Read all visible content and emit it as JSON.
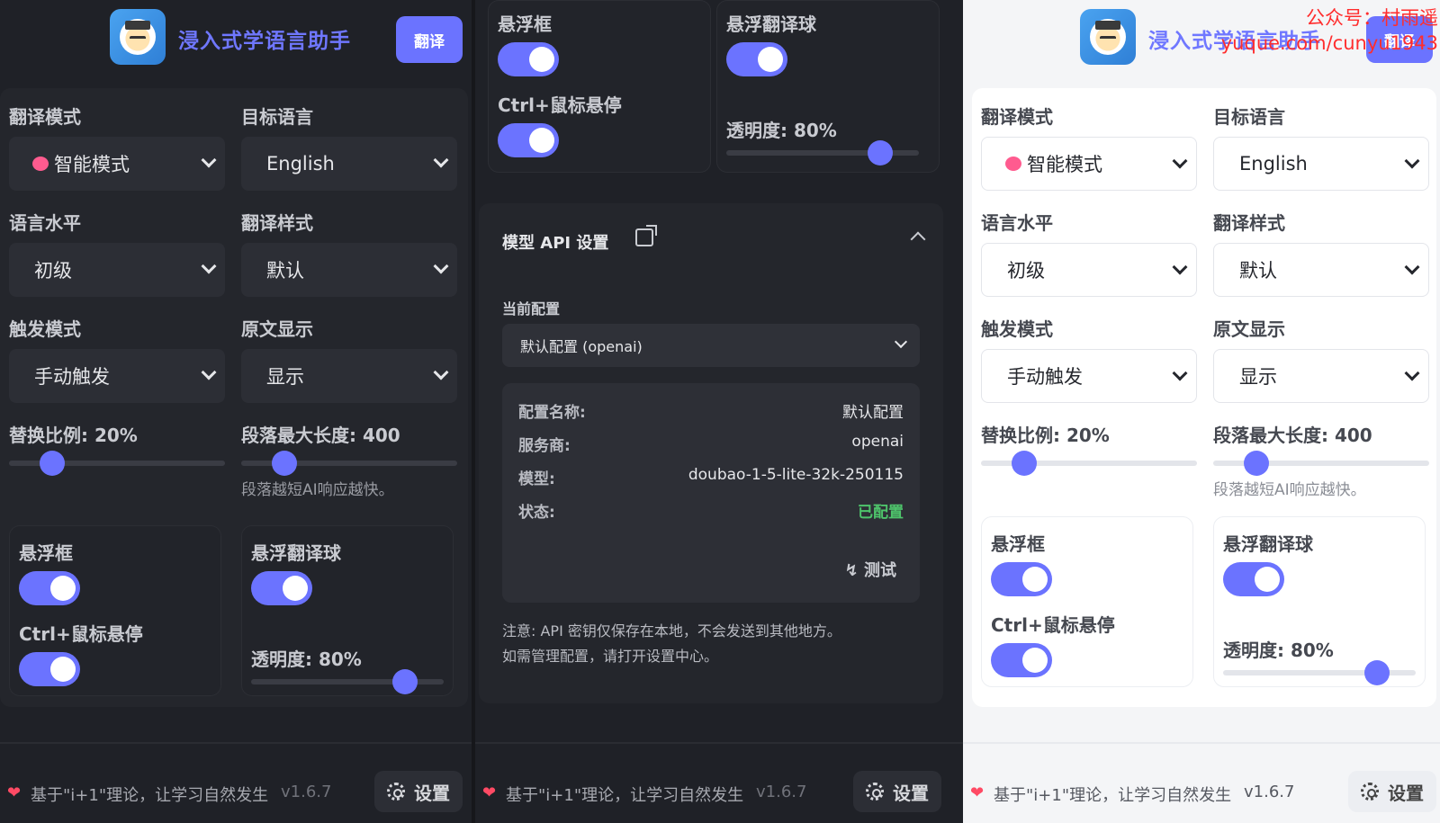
{
  "app": {
    "title": "浸入式学语言助手",
    "translate_button": "翻译"
  },
  "settings": {
    "translate_mode_label": "翻译模式",
    "translate_mode_value": "智能模式",
    "target_lang_label": "目标语言",
    "target_lang_value": "English",
    "level_label": "语言水平",
    "level_value": "初级",
    "style_label": "翻译样式",
    "style_value": "默认",
    "trigger_label": "触发模式",
    "trigger_value": "手动触发",
    "original_label": "原文显示",
    "original_value": "显示",
    "ratio_label": "替换比例: 20%",
    "ratio_value": 0.2,
    "maxlen_label": "段落最大长度: 400",
    "maxlen_value": 0.2,
    "maxlen_hint": "段落越短AI响应越快。",
    "float_box_label": "悬浮框",
    "ctrl_hover_label": "Ctrl+鼠标悬停",
    "float_ball_label": "悬浮翻译球",
    "opacity_label": "透明度: 80%",
    "opacity_value": 0.8
  },
  "api": {
    "title": "模型 API 设置",
    "current_label": "当前配置",
    "current_value": "默认配置 (openai)",
    "rows": [
      {
        "k": "配置名称:",
        "v": "默认配置"
      },
      {
        "k": "服务商:",
        "v": "openai"
      },
      {
        "k": "模型:",
        "v": "doubao-1-5-lite-32k-250115"
      },
      {
        "k": "状态:",
        "v": "已配置"
      }
    ],
    "test_button": "测试",
    "note_line1": "注意: API 密钥仅保存在本地，不会发送到其他地方。",
    "note_line2": "如需管理配置，请打开设置中心。"
  },
  "footer": {
    "slogan": "基于\"i+1\"理论，让学习自然发生",
    "version": "v1.6.7",
    "settings_button": "设置"
  },
  "watermark": {
    "line1": "公众号：村雨遥",
    "line2": "yuque.com/cunyu1943"
  },
  "colors": {
    "accent": "#6b73ff",
    "dark_bg": "#1f2127",
    "light_bg": "#f4f5f7",
    "status_ok": "#4ec46b",
    "heart": "#ff4a64"
  }
}
